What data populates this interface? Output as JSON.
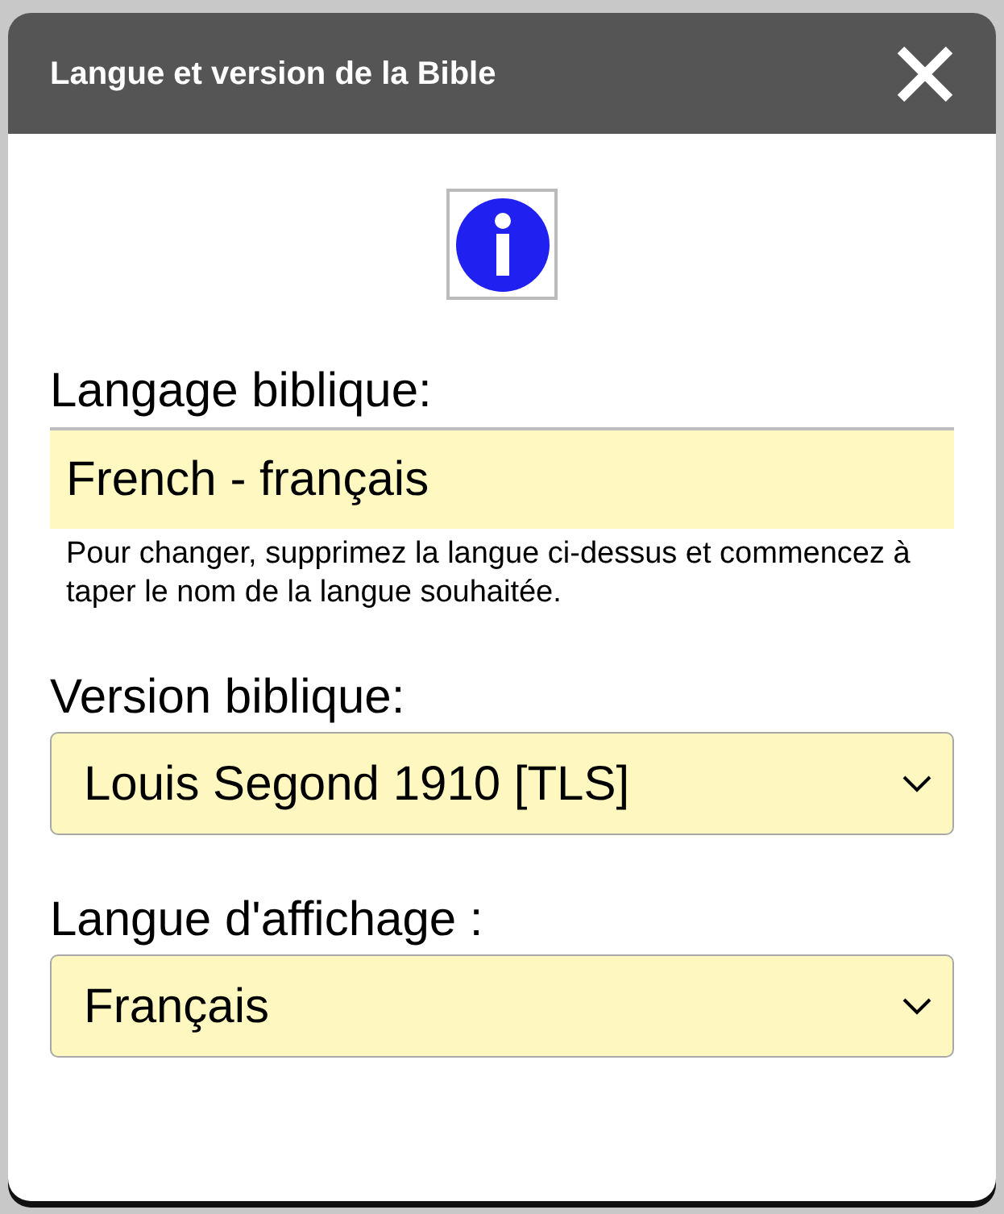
{
  "dialog": {
    "title": "Langue et version de la Bible"
  },
  "language": {
    "label": "Langage biblique:",
    "value": "French - français",
    "help": "Pour changer, supprimez la langue ci-dessus et commencez à taper le nom de la langue souhaitée."
  },
  "selects": [
    {
      "label": "Version biblique:",
      "value": "Louis Segond 1910 [TLS]"
    },
    {
      "label": "Langue d'affichage :",
      "value": "Français"
    }
  ]
}
